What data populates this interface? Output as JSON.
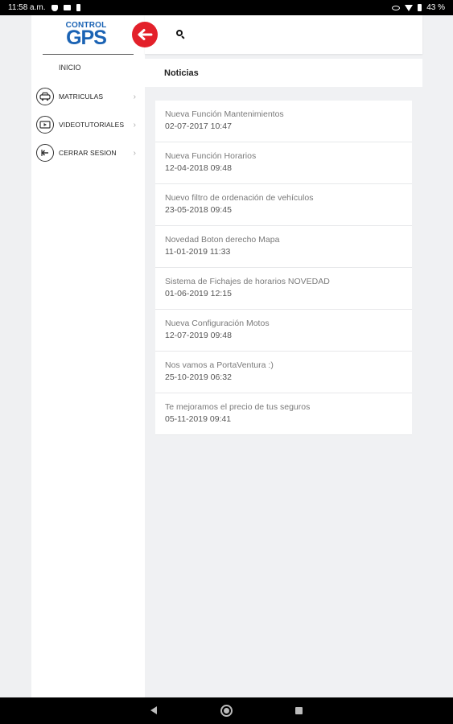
{
  "status_bar": {
    "time": "11:58 a.m.",
    "battery": "43 %",
    "icons": [
      "shield-icon",
      "message-icon",
      "clipboard-icon",
      "eye-icon",
      "wifi-icon",
      "battery-icon"
    ]
  },
  "brand": {
    "logo_small": "CONTROL",
    "logo_big": "GPS",
    "primary_color": "#1b63b4",
    "accent_color": "#e3202a"
  },
  "sidebar": {
    "home_label": "INICIO",
    "items": [
      {
        "label": "MATRICULAS",
        "icon": "car-icon",
        "chevron": "›"
      },
      {
        "label": "VIDEOTUTORIALES",
        "icon": "video-icon",
        "chevron": "›"
      },
      {
        "label": "CERRAR SESION",
        "icon": "logout-icon",
        "chevron": "›"
      }
    ]
  },
  "header": {
    "back_icon": "back-arrow-icon",
    "search_icon": "search-icon"
  },
  "page": {
    "title": "Noticias"
  },
  "news": [
    {
      "title": "Nueva Función Mantenimientos",
      "date": "02-07-2017 10:47"
    },
    {
      "title": "Nueva Función Horarios",
      "date": "12-04-2018 09:48"
    },
    {
      "title": "Nuevo filtro de ordenación de vehículos",
      "date": "23-05-2018 09:45"
    },
    {
      "title": "Novedad Boton derecho Mapa",
      "date": "11-01-2019 11:33"
    },
    {
      "title": "Sistema de Fichajes de horarios NOVEDAD",
      "date": "01-06-2019 12:15"
    },
    {
      "title": "Nueva Configuración Motos",
      "date": "12-07-2019 09:48"
    },
    {
      "title": "Nos vamos a PortaVentura :)",
      "date": "25-10-2019 06:32"
    },
    {
      "title": "Te mejoramos el precio de tus seguros",
      "date": "05-11-2019 09:41"
    }
  ]
}
